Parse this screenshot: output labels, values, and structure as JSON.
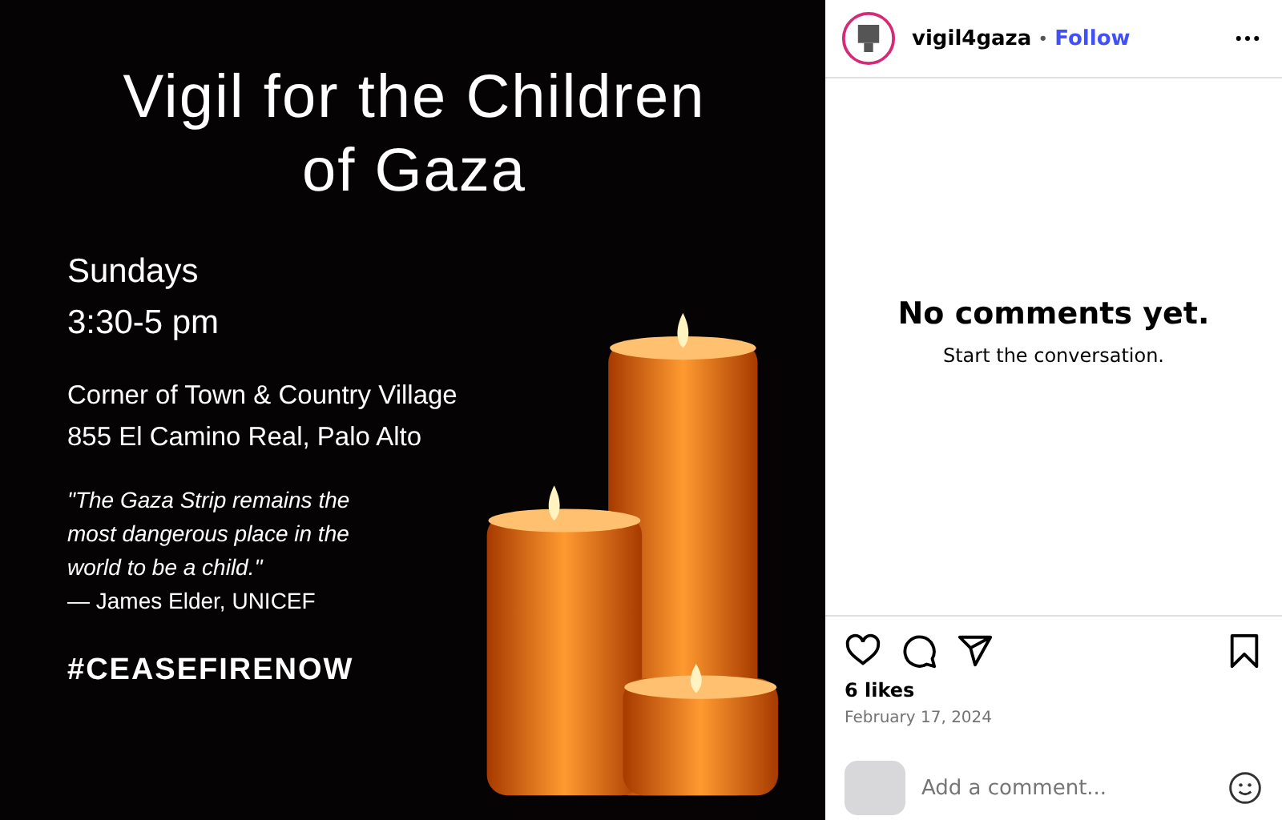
{
  "post_image": {
    "title": "Vigil for the Children of Gaza",
    "schedule": [
      "Sundays",
      "3:30-5 pm"
    ],
    "location": [
      "Corner of Town & Country Village",
      "855 El Camino Real, Palo Alto"
    ],
    "quote": [
      "\"The Gaza Strip remains the",
      "most dangerous place in the",
      "world to be a child.\""
    ],
    "attribution": "— James Elder, UNICEF",
    "hashtag": "#CEASEFIRENOW"
  },
  "header": {
    "username": "vigil4gaza",
    "separator": "•",
    "follow": "Follow"
  },
  "comments": {
    "empty_title": "No comments yet.",
    "empty_hint": "Start the conversation."
  },
  "actions": {
    "liked": false,
    "saved": false
  },
  "likes": "6 likes",
  "date": "February 17, 2024",
  "comment_field": {
    "placeholder": "Add a comment..."
  }
}
